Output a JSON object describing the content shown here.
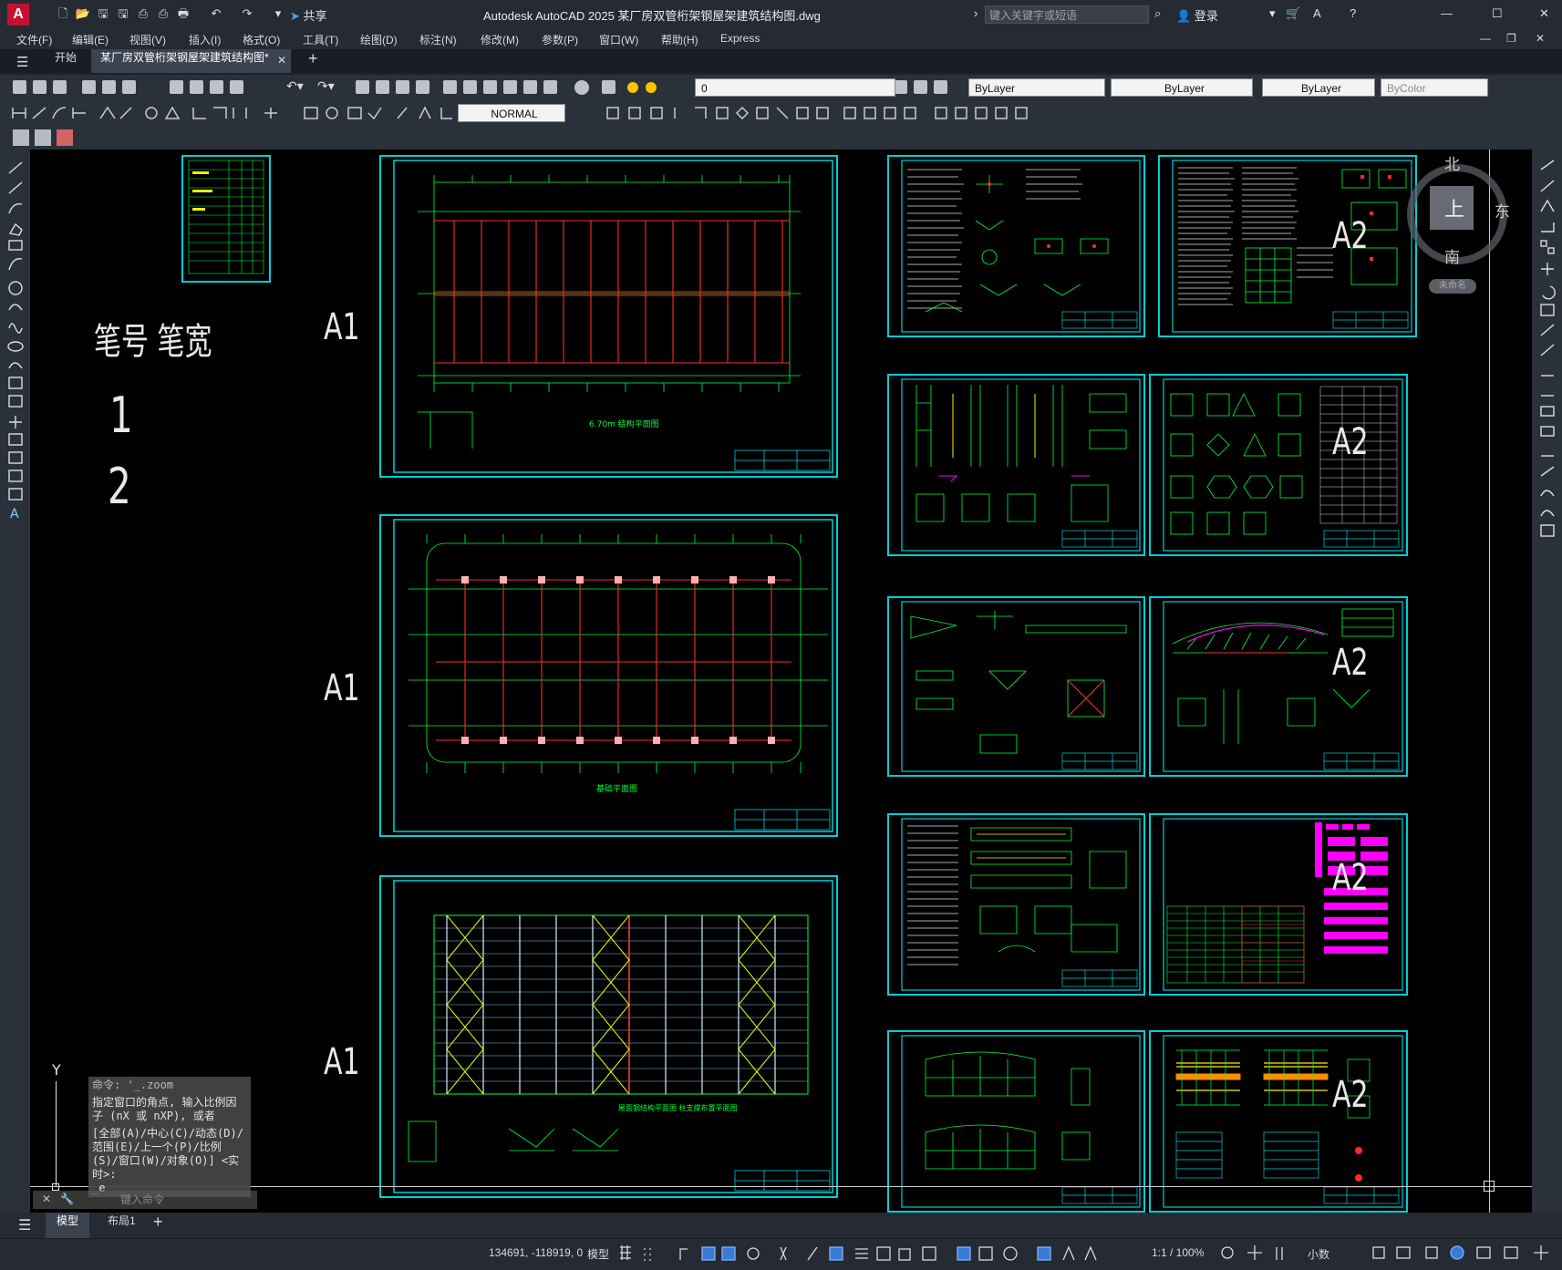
{
  "window": {
    "title": "Autodesk AutoCAD 2025    某厂房双管桁架钢屋架建筑结构图.dwg",
    "share": "共享",
    "search_placeholder": "键入关键字或短语",
    "login": "登录"
  },
  "menu": [
    "文件(F)",
    "编辑(E)",
    "视图(V)",
    "插入(I)",
    "格式(O)",
    "工具(T)",
    "绘图(D)",
    "标注(N)",
    "修改(M)",
    "参数(P)",
    "窗口(W)",
    "帮助(H)",
    "Express"
  ],
  "tabs": {
    "start": "开始",
    "drawing": "某厂房双管桁架钢屋架建筑结构图*",
    "add": "+"
  },
  "toolbar": {
    "layer": "0",
    "color": "ByLayer",
    "linetype": "ByLayer",
    "lineweight": "ByLayer",
    "plotstyle": "ByColor",
    "textstyle": "NORMAL"
  },
  "viewcube": {
    "north": "北",
    "east": "东",
    "south": "南",
    "top": "上",
    "wcs": "未命名"
  },
  "canvas": {
    "pen_header": "笔号  笔宽",
    "pen_1": "1",
    "pen_2": "2",
    "sheet_labels": [
      "A1",
      "A1",
      "A1",
      "A2",
      "A2",
      "A2",
      "A2",
      "A2"
    ],
    "sheet_captions": [
      "6.70m 结构平面图",
      "基础平面图",
      "屋面钢结构平面图 柱支撑布置平面图"
    ],
    "ucs_y": "Y"
  },
  "command": {
    "line1": "命令: '_.zoom",
    "line2": "指定窗口的角点, 输入比例因子 (nX 或 nXP), 或者",
    "line3": "[全部(A)/中心(C)/动态(D)/范围(E)/上一个(P)/比例(S)/窗口(W)/对象(O)] <实时>:",
    "line4": "_e",
    "input_placeholder": "键入命令"
  },
  "layout_tabs": [
    "模型",
    "布局1",
    "+"
  ],
  "status": {
    "coords": "134691, -118919, 0",
    "space": "模型",
    "scale": "1:1 / 100%",
    "units": "小数"
  },
  "colors": {
    "accent": "#00cfd8",
    "green": "#00ff3c",
    "red": "#ff2a2a",
    "magenta": "#ff00ff",
    "yellow": "#ffee00"
  }
}
